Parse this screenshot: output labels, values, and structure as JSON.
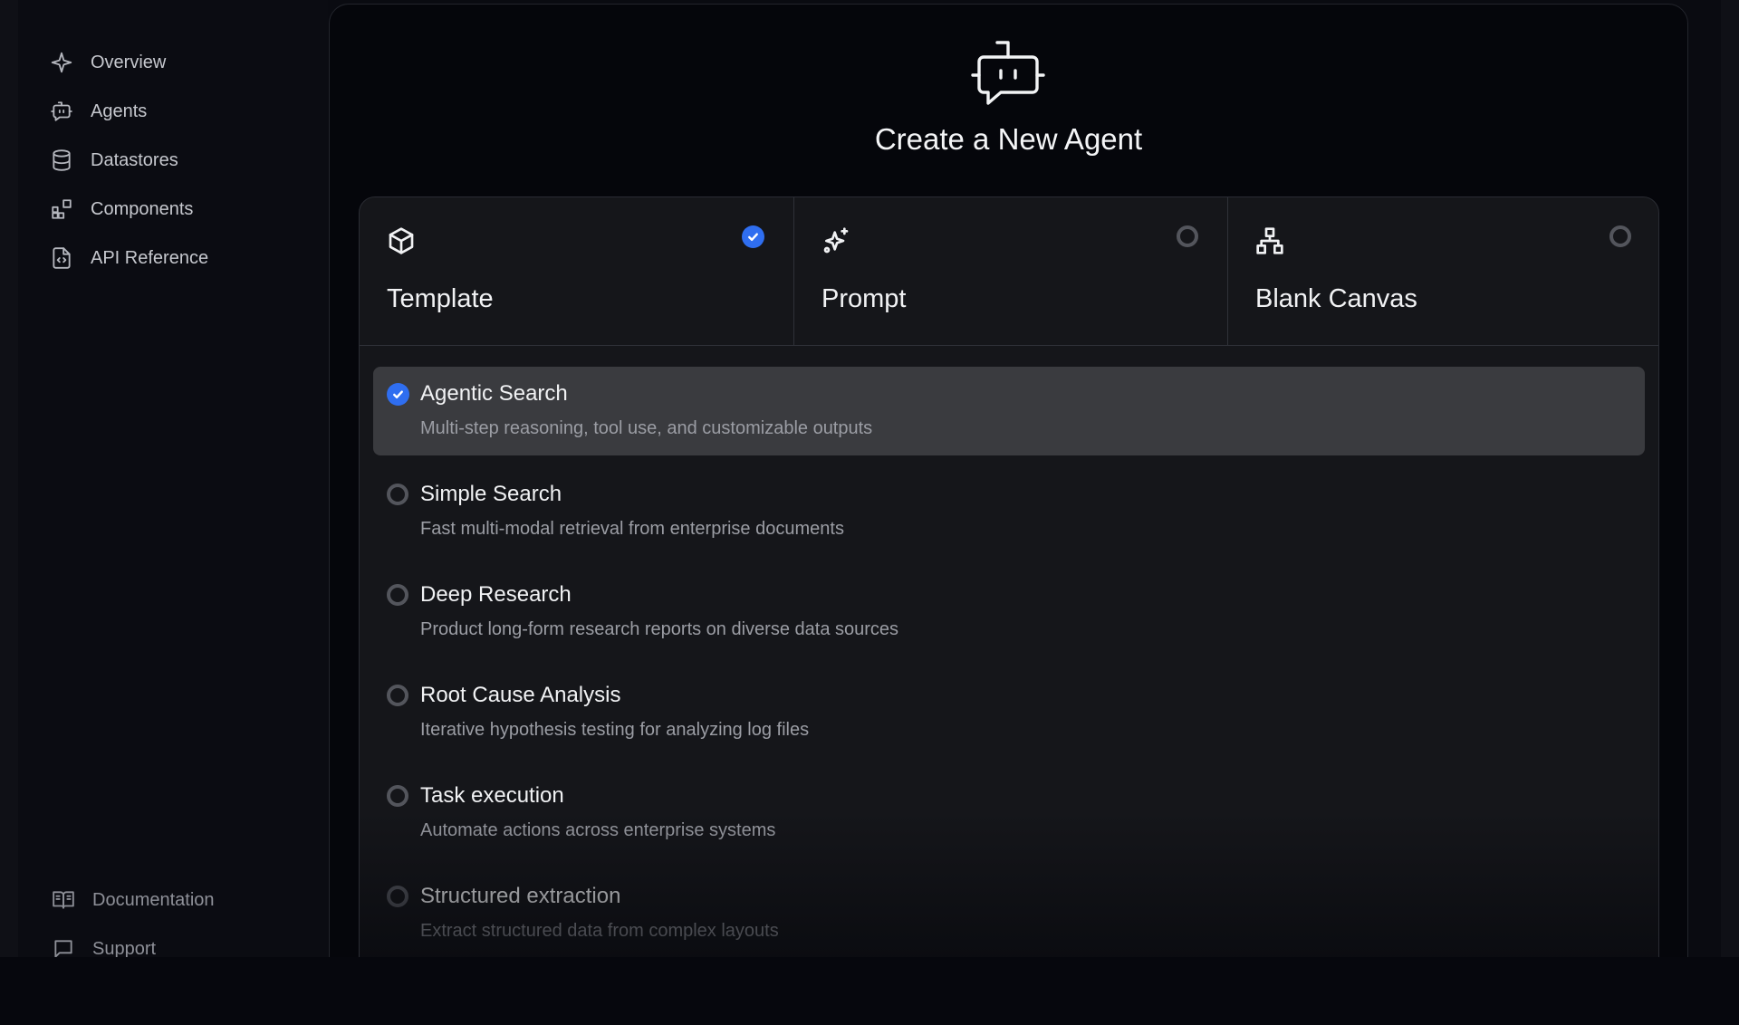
{
  "sidebar": {
    "items": [
      {
        "label": "Overview",
        "icon": "sparkle-icon"
      },
      {
        "label": "Agents",
        "icon": "bot-icon"
      },
      {
        "label": "Datastores",
        "icon": "database-icon"
      },
      {
        "label": "Components",
        "icon": "components-icon"
      },
      {
        "label": "API Reference",
        "icon": "code-file-icon"
      }
    ],
    "bottom_items": [
      {
        "label": "Documentation",
        "icon": "book-icon"
      },
      {
        "label": "Support",
        "icon": "message-icon"
      }
    ]
  },
  "main": {
    "title": "Create a New Agent",
    "hero_icon": "bot-icon",
    "modes": [
      {
        "label": "Template",
        "icon": "cube-icon",
        "selected": true
      },
      {
        "label": "Prompt",
        "icon": "sparkles-icon",
        "selected": false
      },
      {
        "label": "Blank Canvas",
        "icon": "hierarchy-icon",
        "selected": false
      }
    ],
    "templates": [
      {
        "title": "Agentic Search",
        "description": "Multi-step reasoning, tool use, and customizable outputs",
        "selected": true
      },
      {
        "title": "Simple Search",
        "description": "Fast multi-modal retrieval from enterprise documents",
        "selected": false
      },
      {
        "title": "Deep Research",
        "description": "Product long-form research reports on diverse data sources",
        "selected": false
      },
      {
        "title": "Root Cause Analysis",
        "description": "Iterative hypothesis testing for analyzing log files",
        "selected": false
      },
      {
        "title": "Task execution",
        "description": "Automate actions across enterprise systems",
        "selected": false
      },
      {
        "title": "Structured extraction",
        "description": "Extract structured data from complex layouts",
        "selected": false
      }
    ]
  },
  "colors": {
    "accent": "#2f6ef0",
    "background": "#05060b",
    "card": "#15161a",
    "selected_row": "#3a3b3f"
  }
}
